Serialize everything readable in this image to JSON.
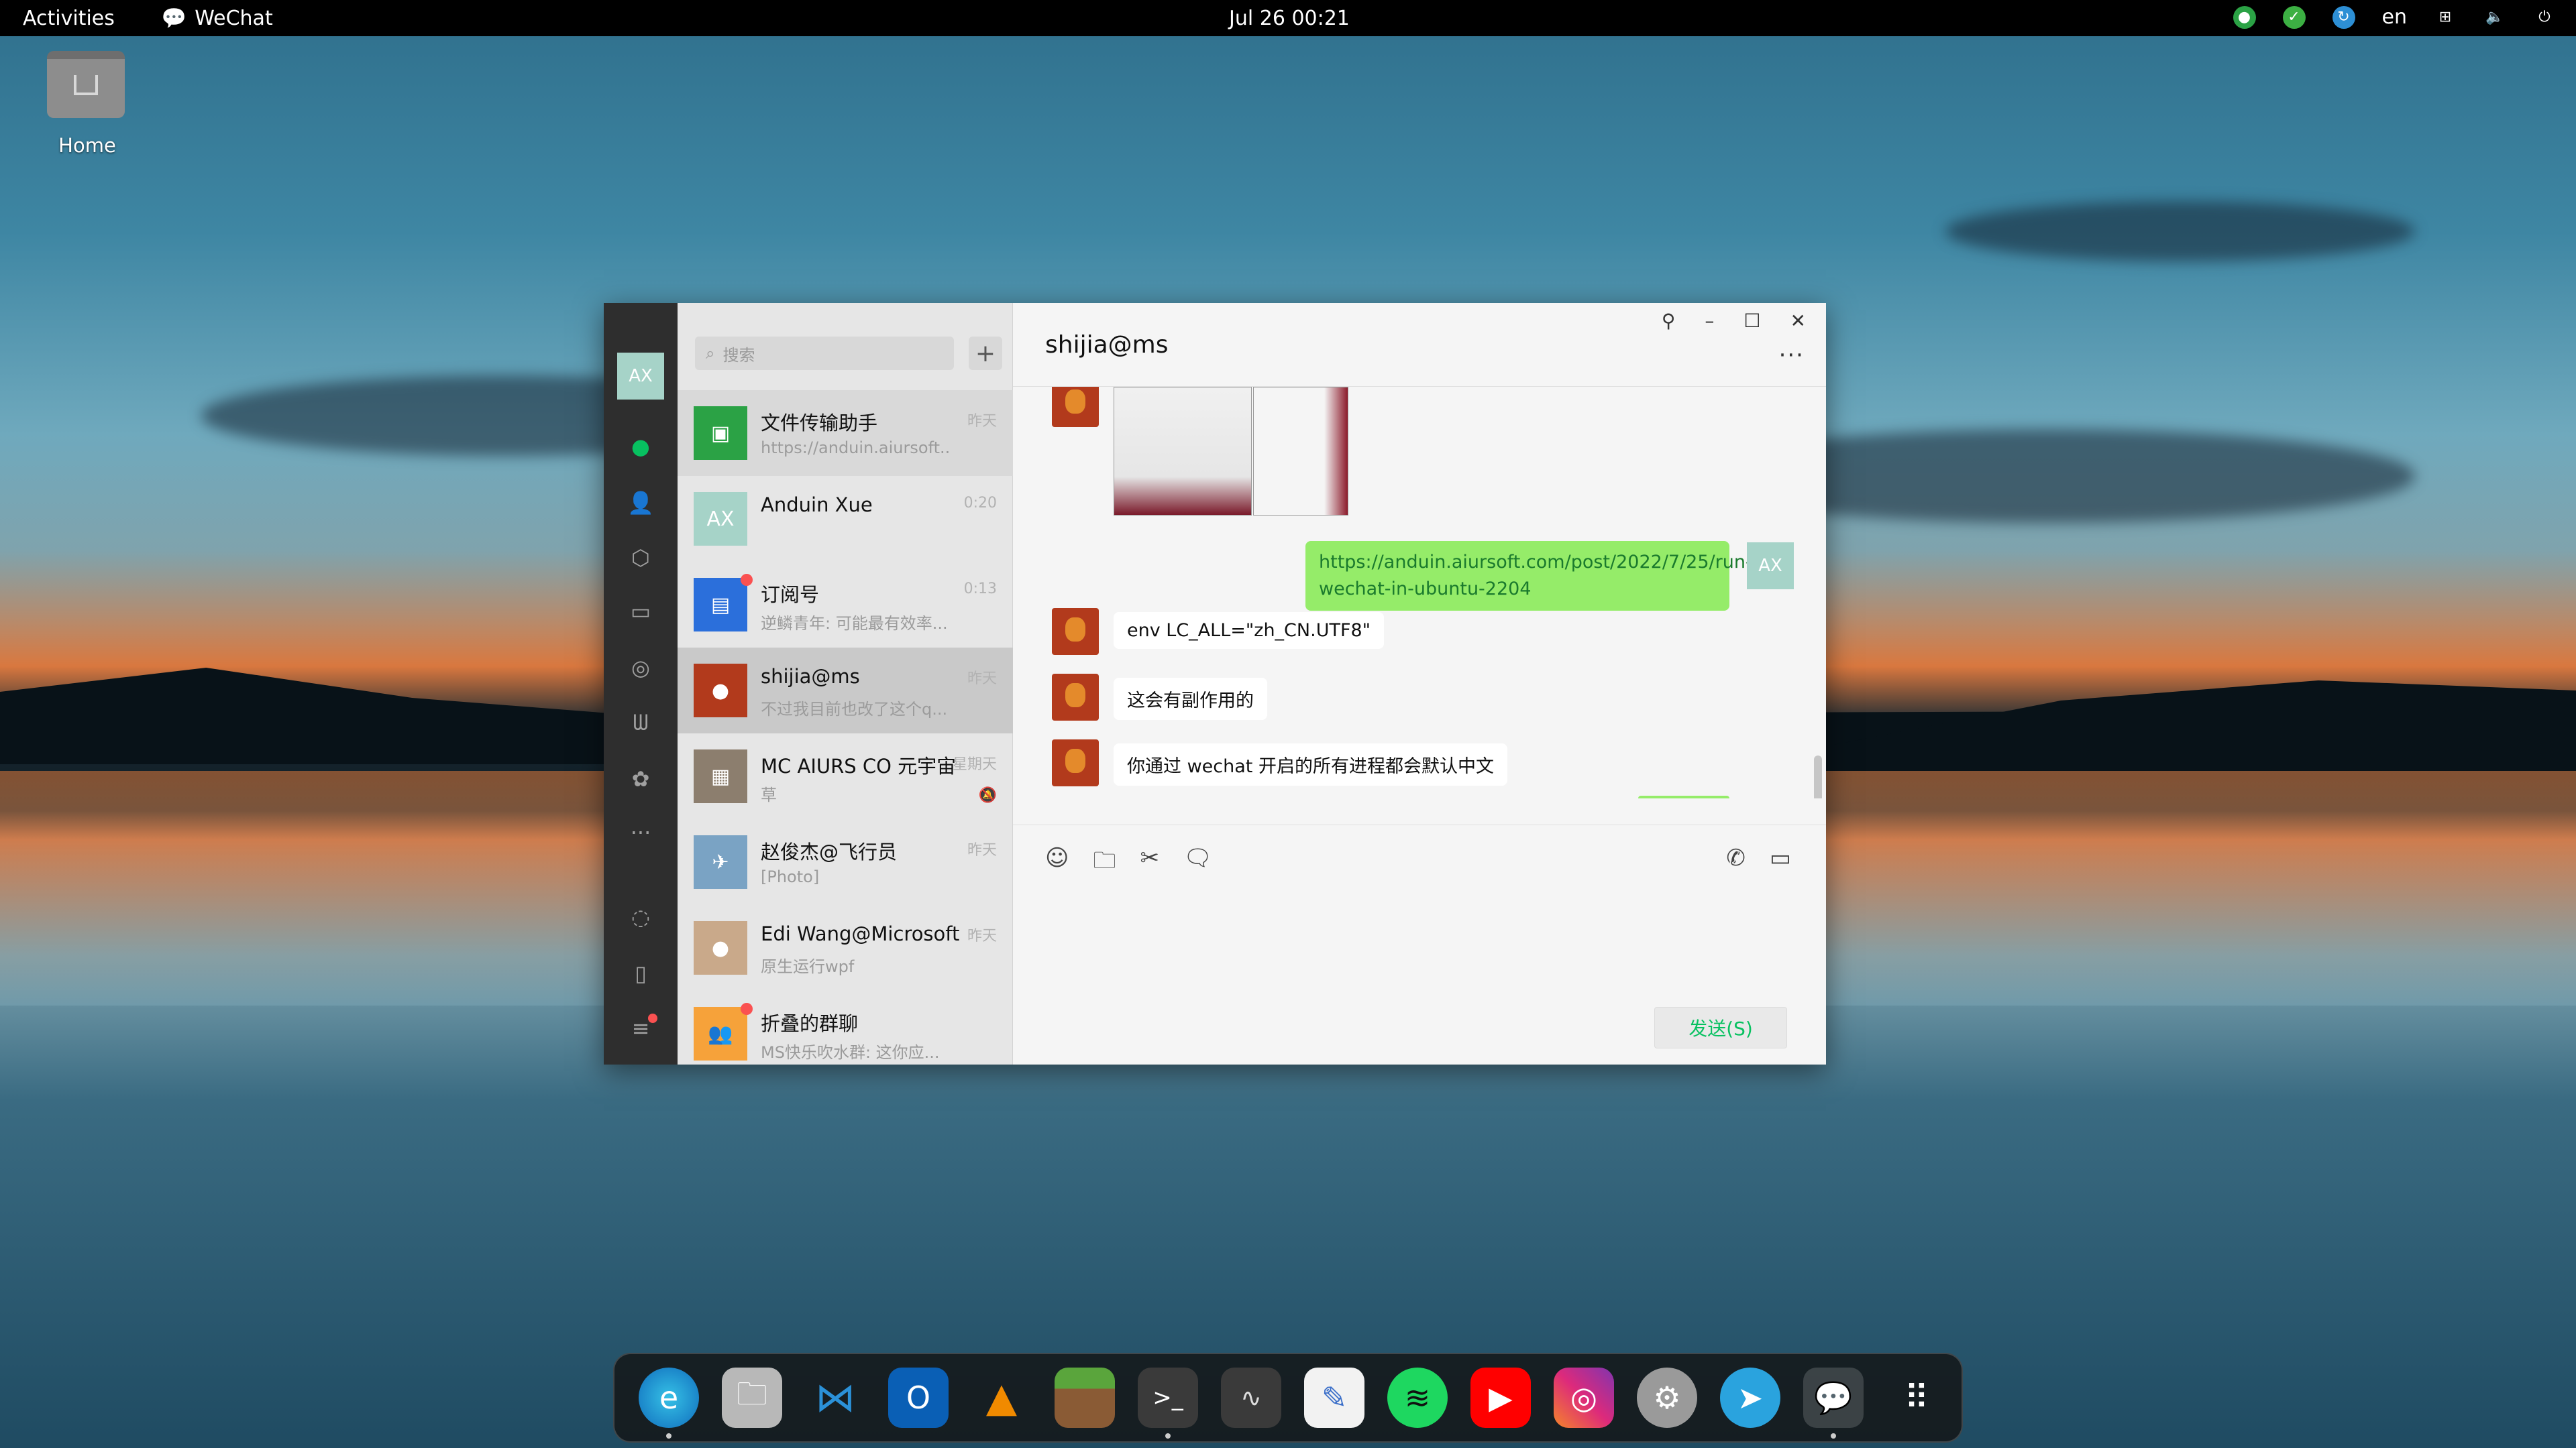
{
  "topbar": {
    "activities": "Activities",
    "app_name": "WeChat",
    "clock": "Jul 26  00:21",
    "language": "en"
  },
  "desktop": {
    "home_label": "Home"
  },
  "wechat": {
    "nav_avatar": "AX",
    "search_placeholder": "搜索",
    "add_label": "+",
    "conversations": [
      {
        "name": "文件传输助手",
        "preview": "https://anduin.aiursoft....",
        "time": "昨天",
        "avatar_color": "#2ba245"
      },
      {
        "name": "Anduin Xue",
        "preview": "",
        "time": "0:20",
        "avatar_text": "AX",
        "avatar_color": "#a6d3c8"
      },
      {
        "name": "订阅号",
        "preview": "逆鳞青年: 可能最有效率...",
        "time": "0:13",
        "avatar_color": "#2b6fdb"
      },
      {
        "name": "shijia@ms",
        "preview": "不过我目前也改了这个q...",
        "time": "昨天",
        "avatar_color": "#b23a1c"
      },
      {
        "name": "MC AIURS CO 元宇宙",
        "preview": "草",
        "time": "星期天",
        "avatar_color": "#8c7e6e"
      },
      {
        "name": "赵俊杰@飞行员",
        "preview": "[Photo]",
        "time": "昨天",
        "avatar_color": "#7aa3c4"
      },
      {
        "name": "Edi Wang@Microsoft",
        "preview": "原生运行wpf",
        "time": "昨天",
        "avatar_color": "#c9a98a"
      },
      {
        "name": "折叠的群聊",
        "preview": "MS快乐吹水群: 这你应...",
        "time": "",
        "avatar_color": "#f6a23a"
      }
    ],
    "chat": {
      "title": "shijia@ms",
      "more": "···",
      "my_avatar": "AX",
      "messages": [
        {
          "from": "me",
          "text": "https://anduin.aiursoft.com/post/2022/7/25/run-wechat-in-ubuntu-2204"
        },
        {
          "from": "other",
          "text": "env LC_ALL=\"zh_CN.UTF8\""
        },
        {
          "from": "other",
          "text": "这会有副作用的"
        },
        {
          "from": "other",
          "text": "你通过 wechat 开启的所有进程都会默认中文"
        }
      ],
      "send_label": "发送(S)"
    }
  },
  "colors": {
    "wechat_green": "#07c160",
    "bubble_green": "#95ec69",
    "nav_bg": "#2e2e2e"
  }
}
